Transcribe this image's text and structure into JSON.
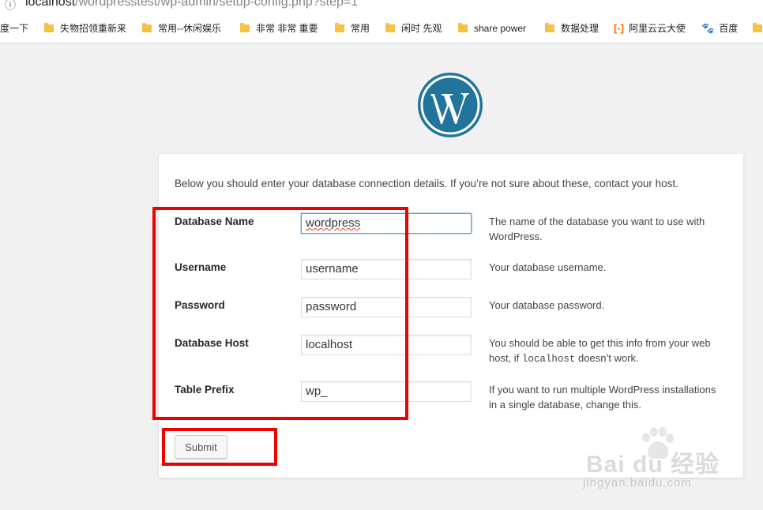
{
  "browser": {
    "url_host": "localhost",
    "url_path": "/wordpresstest/wp-admin/setup-config.php?step=1",
    "info_icon": "info-icon",
    "bookmarks": [
      {
        "label": "度一下",
        "icon": "none"
      },
      {
        "label": "失物招领重新来",
        "icon": "folder-icon"
      },
      {
        "label": "常用--休闲娱乐",
        "icon": "folder-icon"
      },
      {
        "label": "非常 非常 重要",
        "icon": "folder-icon"
      },
      {
        "label": "常用",
        "icon": "folder-icon"
      },
      {
        "label": "闲时 先观",
        "icon": "folder-icon"
      },
      {
        "label": "share power",
        "icon": "folder-icon"
      },
      {
        "label": "数据处理",
        "icon": "folder-icon"
      },
      {
        "label": "阿里云云大使",
        "icon": "aliyun-icon"
      },
      {
        "label": "百度",
        "icon": "baidu-paw-icon"
      }
    ]
  },
  "setup": {
    "intro": "Below you should enter your database connection details. If you’re not sure about these, contact your host.",
    "fields": [
      {
        "label": "Database Name",
        "value": "wordpress",
        "desc": "The name of the database you want to use with WordPress."
      },
      {
        "label": "Username",
        "value": "username",
        "desc": "Your database username."
      },
      {
        "label": "Password",
        "value": "password",
        "desc": "Your database password."
      },
      {
        "label": "Database Host",
        "value": "localhost",
        "desc_before": "You should be able to get this info from your web host, if ",
        "desc_code": "localhost",
        "desc_after": " doesn’t work."
      },
      {
        "label": "Table Prefix",
        "value": "wp_",
        "desc": "If you want to run multiple WordPress installations in a single database, change this."
      }
    ],
    "submit_label": "Submit"
  },
  "watermark": {
    "logo_text": "Bai du 经验",
    "url_text": "jingyan.baidu.com"
  },
  "colors": {
    "annotation_red": "#ef0000",
    "wp_blue": "#21759b",
    "page_bg": "#f1f1f1"
  }
}
